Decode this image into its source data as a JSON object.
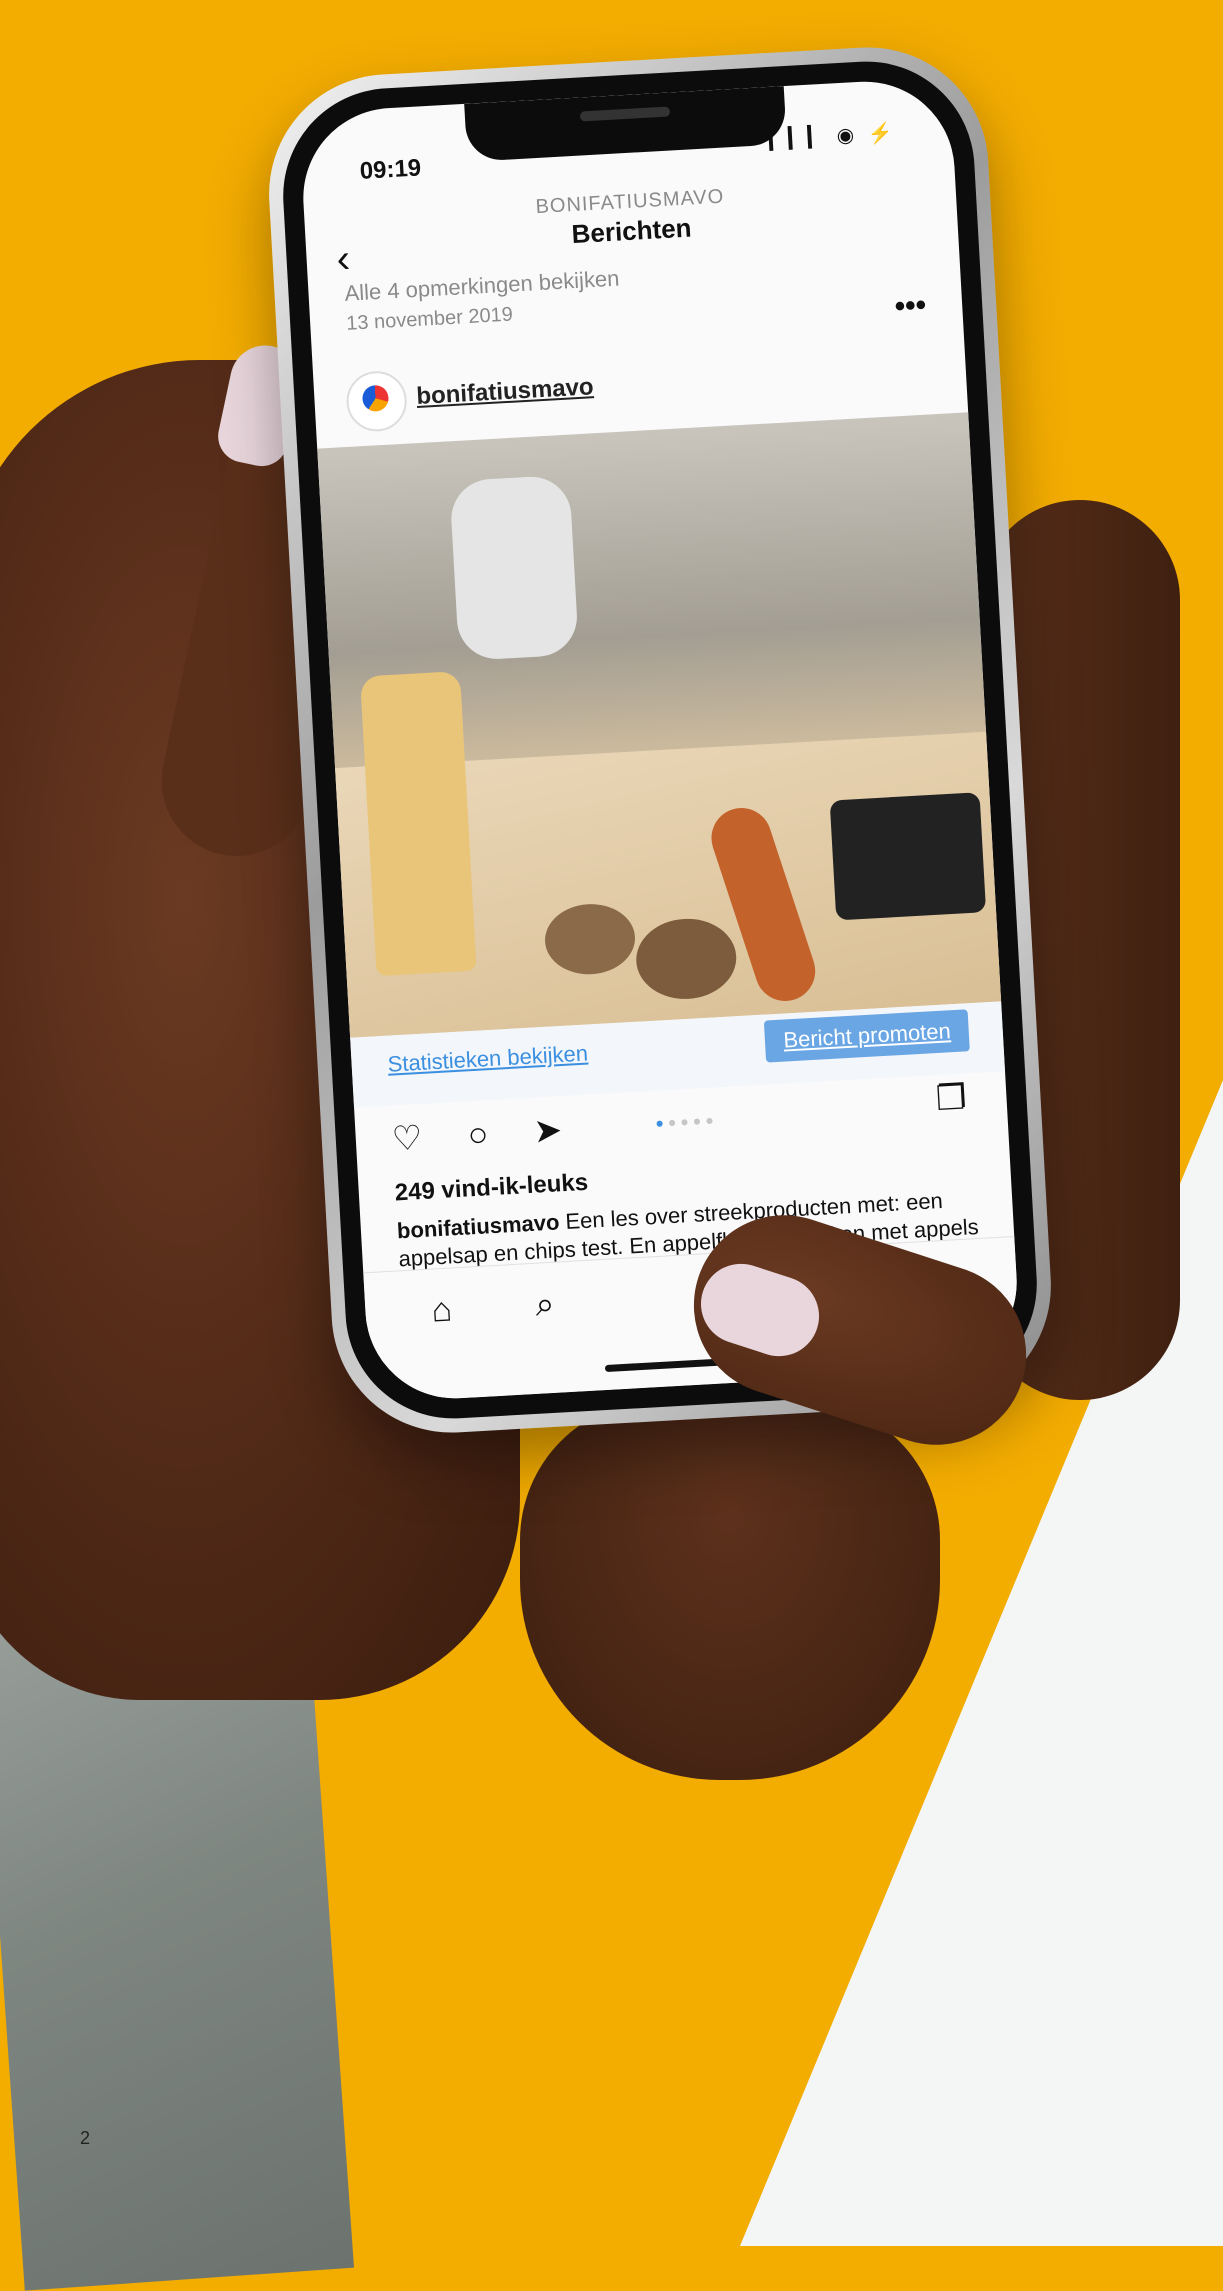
{
  "status_bar": {
    "time": "09:19",
    "icons": "▎▎▎ ◉ ⚡"
  },
  "header": {
    "account": "BONIFATIUSMAVO",
    "title": "Berichten"
  },
  "feed": {
    "comments_link": "Alle 4 opmerkingen bekijken",
    "date": "13 november 2019"
  },
  "post": {
    "username": "bonifatiusmavo",
    "stats_link": "Statistieken bekijken",
    "promote_button": "Bericht promoten",
    "likes": "249 vind-ik-leuks",
    "caption_user": "bonifatiusmavo",
    "caption_text": " Een les over streekproducten met: een appelsap en chips test. En appelflappen bakken met appels uit de Polder 🍎 🍏"
  },
  "icons": {
    "back": "‹",
    "more": "•••",
    "like": "♡",
    "comment": "○",
    "share": "➤",
    "bookmark": "❐",
    "home": "⌂",
    "search": "⌕"
  },
  "page_number": "2",
  "colors": {
    "background": "#F3AC00",
    "link": "#3b8fe0",
    "promote": "#6aa6e4"
  }
}
